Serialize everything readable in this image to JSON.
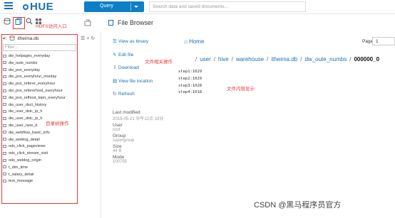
{
  "header": {
    "logo_text": "HUE",
    "query_label": "Query",
    "search_placeholder": "Search data and saved documents..."
  },
  "annotations": {
    "hdfs_entry": "HDFS访问入口",
    "file_ops": "文件相关操作",
    "content_display": "文件内容显示",
    "tree_ops": "目录树操作"
  },
  "tree": {
    "current_db": "itheima.db",
    "filter_placeholder": "Filter...",
    "items": [
      "dw_hotpages_everyday",
      "dw_oute_numbs",
      "dw_pvs_everyday",
      "dw_pvs_everyhour_oneday",
      "dw_pvs_referer_everyhour",
      "dw_pvs_refererhost_everyhour",
      "dw_pvs_refhost_topn_everyhour",
      "dw_user_dsct_history",
      "dw_user_dstc_ip_h",
      "dw_user_dstc_ip_h",
      "dw_user_new_d",
      "dw_webflow_basic_info",
      "dw_weblog_detail",
      "ods_click_pageviews",
      "ods_click_stream_visit",
      "ods_weblog_origin",
      "t_dim_time",
      "t_salary_detail",
      "test_message"
    ]
  },
  "file_browser": {
    "title": "File Browser",
    "actions": [
      {
        "icon": "view-binary-icon",
        "label": "View as binary"
      },
      {
        "icon": "edit-icon",
        "label": "Edit file"
      },
      {
        "icon": "download-icon",
        "label": "Download"
      },
      {
        "icon": "location-icon",
        "label": "View file location"
      },
      {
        "icon": "refresh-icon",
        "label": "Refresh"
      }
    ],
    "home_label": "Home",
    "page_label": "Page",
    "page_value": "1",
    "breadcrumbs": [
      "user",
      "hive",
      "warehouse",
      "itheima.db",
      "dw_oute_numbs",
      "000000_0"
    ],
    "content_lines": [
      "step1:1029",
      "step2:1029",
      "step3:1028",
      "step4:1018"
    ],
    "metadata": [
      {
        "label": "Last modified",
        "value": "2019-05-21 中午12点 19分"
      },
      {
        "label": "User",
        "value": "root"
      },
      {
        "label": "Group",
        "value": "supergroup"
      },
      {
        "label": "Size",
        "value": "44 B"
      },
      {
        "label": "Mode",
        "value": "100755"
      }
    ]
  },
  "watermark": "CSDN @黑马程序员官方"
}
